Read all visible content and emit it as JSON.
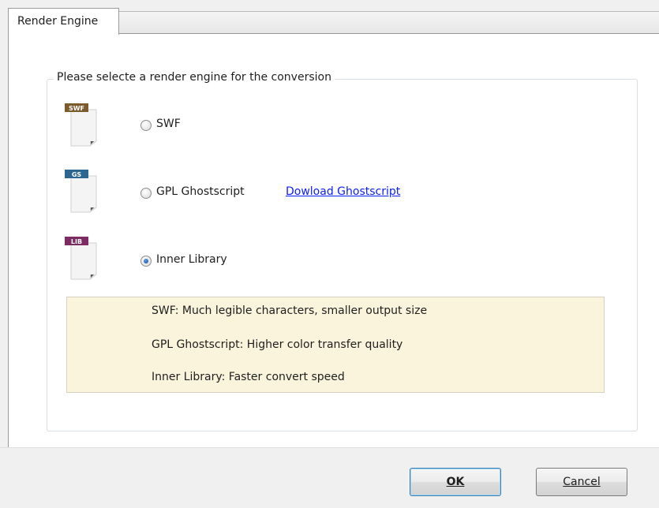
{
  "tabs": [
    {
      "label": "Render Engine",
      "active": true
    }
  ],
  "group": {
    "legend": "Please selecte a render engine for the conversion"
  },
  "options": [
    {
      "icon": "swf-file-icon",
      "badge": "SWF",
      "badge_color": "#7b5a2b",
      "label": "SWF",
      "selected": false
    },
    {
      "icon": "ghostscript-file-icon",
      "badge": "GS",
      "badge_color": "#2d6690",
      "label": "GPL Ghostscript",
      "selected": false,
      "link": "Dowload Ghostscript"
    },
    {
      "icon": "library-file-icon",
      "badge": "LIB",
      "badge_color": "#7d2b62",
      "label": "Inner Library",
      "selected": true
    }
  ],
  "info": [
    "SWF: Much legible characters, smaller output size",
    "GPL Ghostscript: Higher color transfer quality",
    "Inner Library: Faster convert speed"
  ],
  "buttons": {
    "ok": "OK",
    "cancel": "Cancel"
  },
  "colors": {
    "link": "#0b1ff0",
    "info_background": "#faf4dc",
    "selected_radio": "#1f5aa8"
  }
}
